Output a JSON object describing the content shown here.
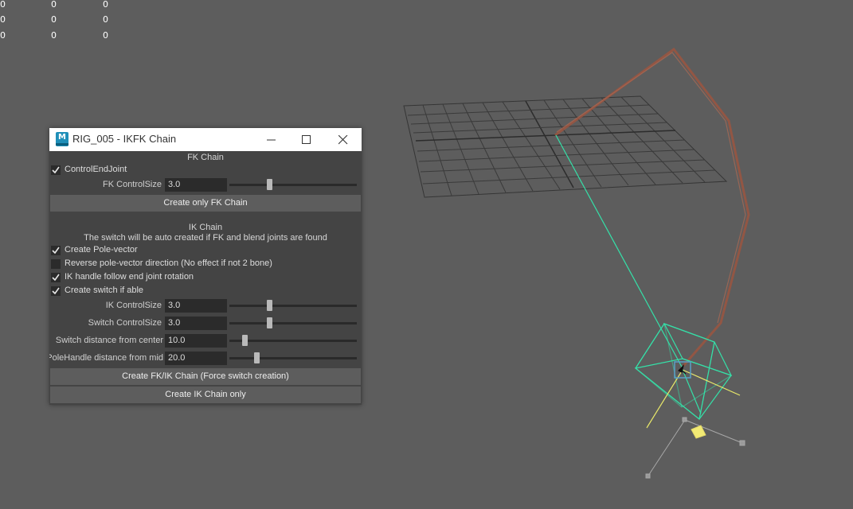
{
  "hud": {
    "rows": [
      [
        "0",
        "0",
        "0"
      ],
      [
        "0",
        "0",
        "0"
      ],
      [
        "0",
        "0",
        "0"
      ]
    ]
  },
  "window": {
    "title": "RIG_005 - IKFK Chain",
    "icon_letter": "M",
    "icons": {
      "app": "maya-app-icon",
      "minimize": "minimize-icon",
      "maximize": "maximize-icon",
      "close": "close-icon"
    },
    "fk": {
      "header": "FK Chain",
      "control_end_joint": {
        "label": "ControlEndJoint",
        "checked": true
      },
      "control_size": {
        "label": "FK ControlSize",
        "value": "3.0",
        "slider": 0.3
      },
      "create_button": "Create only FK Chain"
    },
    "ik": {
      "header": "IK Chain",
      "note": "The switch will be auto created if FK and blend joints are found",
      "create_pole_vector": {
        "label": "Create Pole-vector",
        "checked": true
      },
      "reverse_pole_vector": {
        "label": "Reverse pole-vector direction (No effect if not 2 bone)",
        "checked": false
      },
      "follow_end_rotation": {
        "label": "IK handle follow end joint rotation",
        "checked": true
      },
      "create_switch": {
        "label": "Create switch if able",
        "checked": true
      },
      "control_size": {
        "label": "IK ControlSize",
        "value": "3.0",
        "slider": 0.3
      },
      "switch_control_size": {
        "label": "Switch ControlSize",
        "value": "3.0",
        "slider": 0.3
      },
      "switch_distance": {
        "label": "Switch distance from center",
        "value": "10.0",
        "slider": 0.1
      },
      "handle_distance": {
        "label": "IK PoleHandle distance from mid",
        "value": "20.0",
        "slider": 0.2
      },
      "create_fkik_button": "Create FK/IK Chain (Force switch creation)",
      "create_ik_button": "Create IK Chain only"
    }
  },
  "colors": {
    "viewport_bg": "#5d5d5d",
    "grid": "#3a3a3a",
    "ik_chain": "#35e0a8",
    "fk_chain": "#a45a3f",
    "axis_yellow": "#e8e86a"
  }
}
